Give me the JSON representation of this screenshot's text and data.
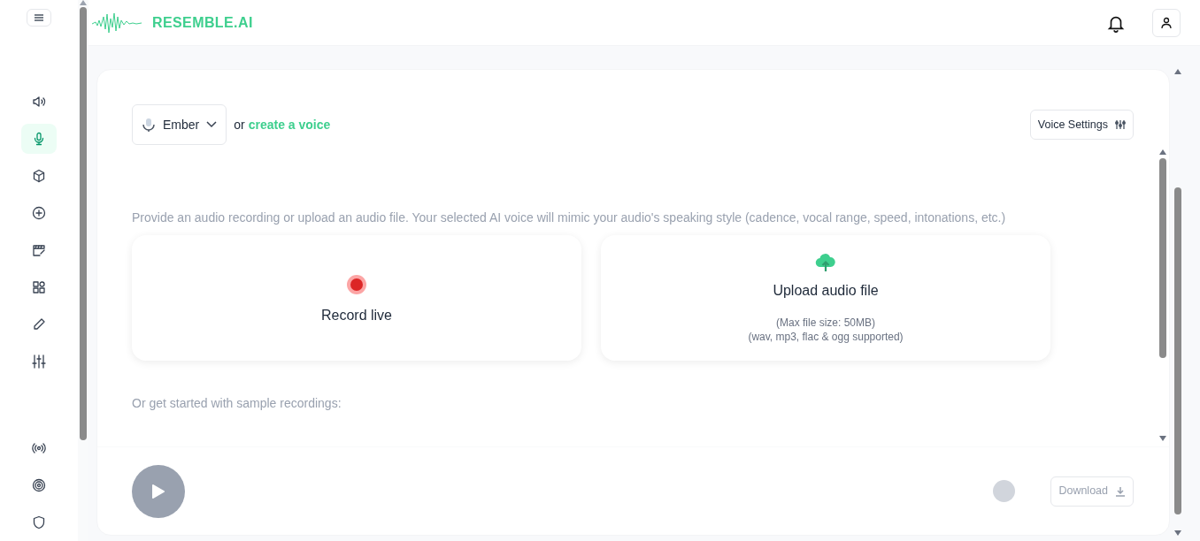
{
  "sidebar": {
    "items": [
      {
        "kind": "speaker",
        "selected": false
      },
      {
        "kind": "mic",
        "selected": true
      },
      {
        "kind": "cube",
        "selected": false
      },
      {
        "kind": "plus",
        "selected": false
      },
      {
        "kind": "clapper",
        "selected": false
      },
      {
        "kind": "apps",
        "selected": false
      },
      {
        "kind": "pencil",
        "selected": false
      },
      {
        "kind": "sliders",
        "selected": false
      },
      {
        "kind": "broadcast",
        "selected": false
      },
      {
        "kind": "target",
        "selected": false
      },
      {
        "kind": "shield",
        "selected": false
      }
    ]
  },
  "header": {
    "logo": "RESEMBLE.AI"
  },
  "voice": {
    "name": "Ember",
    "or": "or",
    "create_link": "create a voice",
    "settings_button": "Voice Settings"
  },
  "description": "Provide an audio recording or upload an audio file. Your selected AI voice will mimic your audio's speaking style (cadence, vocal range, speed, intonations, etc.)",
  "options": [
    {
      "kind": "record",
      "title": "Record live"
    },
    {
      "kind": "upload",
      "title": "Upload audio file",
      "notes": [
        "(Max file size: 50MB)",
        "(wav, mp3, flac & ogg supported)"
      ]
    }
  ],
  "samples_label": "Or get started with sample recordings:",
  "player": {
    "disabled": true,
    "download": "Download"
  }
}
